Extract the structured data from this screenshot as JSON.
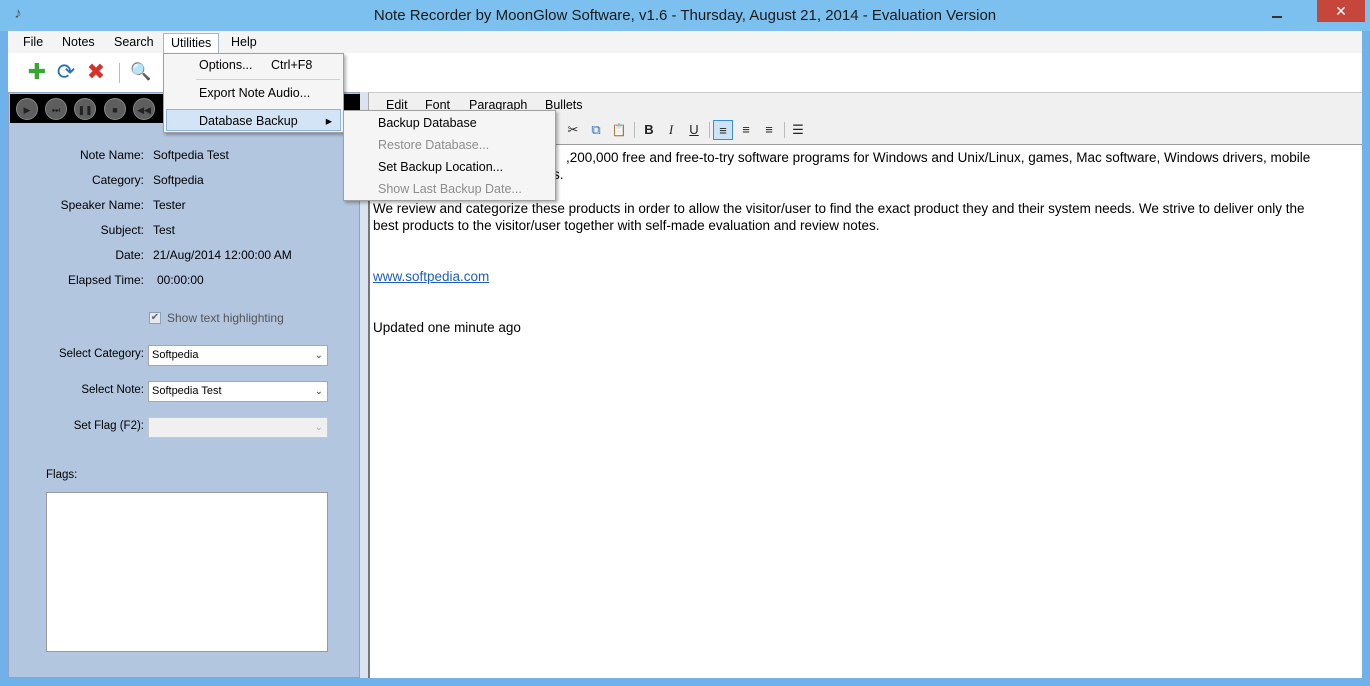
{
  "window": {
    "title": "Note Recorder by MoonGlow Software, v1.6  -  Thursday, August 21, 2014  -  Evaluation Version",
    "close_glyph": "✕",
    "app_icon_glyph": "♪"
  },
  "menubar": {
    "items": [
      "File",
      "Notes",
      "Search",
      "Utilities",
      "Help"
    ]
  },
  "toolbar": {
    "icons": [
      "add-icon",
      "refresh-icon",
      "delete-icon",
      "search-icon"
    ],
    "add_glyph": "✚",
    "refresh_glyph": "⟳",
    "delete_glyph": "✖",
    "search_glyph": "🔍"
  },
  "player": {
    "controls": [
      "play-icon",
      "next-icon",
      "pause-icon",
      "stop-icon",
      "rewind-icon"
    ],
    "play_glyph": "▶",
    "next_glyph": "⏭",
    "pause_glyph": "❚❚",
    "stop_glyph": "■",
    "rewind_glyph": "◀◀"
  },
  "details": {
    "note_name_label": "Note Name:",
    "note_name": "Softpedia Test",
    "category_label": "Category:",
    "category": "Softpedia",
    "speaker_label": "Speaker Name:",
    "speaker": "Tester",
    "subject_label": "Subject:",
    "subject": "Test",
    "date_label": "Date:",
    "date": "21/Aug/2014 12:00:00 AM",
    "elapsed_label": "Elapsed Time:",
    "elapsed": "00:00:00"
  },
  "options": {
    "highlight_label": "Show text highlighting",
    "highlight_checked": true,
    "check_glyph": "✔",
    "select_category_label": "Select Category:",
    "select_category_value": "Softpedia",
    "select_note_label": "Select Note:",
    "select_note_value": "Softpedia Test",
    "set_flag_label": "Set Flag (F2):",
    "set_flag_value": "",
    "flags_label": "Flags:",
    "dropdown_glyph": "⌄"
  },
  "editor": {
    "menu": [
      "Edit",
      "Font",
      "Paragraph",
      "Bullets"
    ],
    "toolbar": {
      "cut_glyph": "✂",
      "copy_glyph": "⧉",
      "paste_glyph": "📋",
      "bold_glyph": "B",
      "italic_glyph": "I",
      "underline_glyph": "U",
      "align_left_glyph": "≡",
      "align_center_glyph": "≡",
      "align_right_glyph": "≡",
      "bullets_glyph": "☰"
    },
    "paragraphs": {
      "p1_line1": ",200,000 free and free-to-try software programs for Windows and Unix/Linux, games, Mac software, Windows drivers, mobile",
      "p1_line2": "s.",
      "p2_line1": "We review and categorize these products in order to allow the visitor/user to find the exact product they and their system needs. We strive to deliver only the",
      "p2_line2": "best products to the visitor/user together with self-made evaluation and review notes.",
      "link": "www.softpedia.com",
      "updated": "Updated one minute ago"
    }
  },
  "utilities_menu": {
    "options_label": "Options...",
    "options_shortcut": "Ctrl+F8",
    "export_label": "Export Note Audio...",
    "backup_label": "Database Backup",
    "submenu_arrow": "▸"
  },
  "backup_submenu": {
    "backup": "Backup Database",
    "restore": "Restore Database...",
    "set_location": "Set Backup Location...",
    "show_last": "Show Last Backup Date..."
  },
  "colors": {
    "title_bar": "#7cc0ef",
    "left_panel": "#b3c6df",
    "close_button": "#c7463b",
    "menu_highlight": "#d3e4f7",
    "link": "#1c5ec7"
  }
}
